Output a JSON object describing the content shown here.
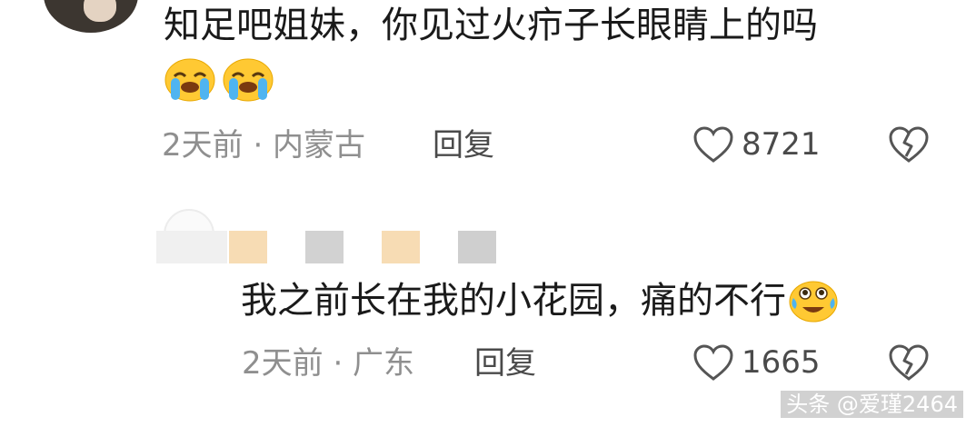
{
  "comments": [
    {
      "text": "知足吧姐妹，你见过火疖子长眼睛上的吗",
      "emojis": [
        "loudly-crying-face-icon",
        "loudly-crying-face-icon"
      ],
      "meta": "2天前 · 内蒙古",
      "reply_label": "回复",
      "like_count": "8721"
    },
    {
      "text": "我之前长在我的小花园，痛的不行",
      "emojis": [
        "tears-of-joy-face-icon"
      ],
      "meta": "2天前 · 广东",
      "reply_label": "回复",
      "like_count": "1665"
    }
  ],
  "watermark": "头条 @爱瑾2464",
  "colors": {
    "text_primary": "#1a1a1a",
    "text_meta": "#8f8f8f",
    "text_action": "#4a4a4a",
    "emoji_yellow": "#ffc933",
    "emoji_tear": "#4fb4f0"
  }
}
